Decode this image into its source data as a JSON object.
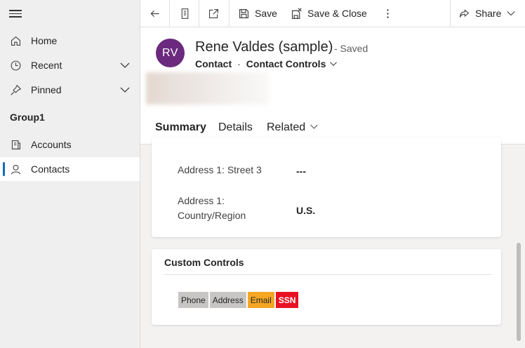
{
  "sidebar": {
    "items": [
      {
        "label": "Home",
        "icon": "home-icon"
      },
      {
        "label": "Recent",
        "icon": "clock-icon",
        "expandable": true
      },
      {
        "label": "Pinned",
        "icon": "pin-icon",
        "expandable": true
      }
    ],
    "group_label": "Group1",
    "group_items": [
      {
        "label": "Accounts",
        "icon": "accounts-icon"
      },
      {
        "label": "Contacts",
        "icon": "person-icon",
        "active": true
      }
    ]
  },
  "commandbar": {
    "save_label": "Save",
    "save_close_label": "Save & Close",
    "share_label": "Share"
  },
  "record": {
    "initials": "RV",
    "title": "Rene Valdes (sample)",
    "status": "- Saved",
    "entity": "Contact",
    "form": "Contact Controls"
  },
  "tabs": [
    {
      "label": "Summary",
      "active": true
    },
    {
      "label": "Details"
    },
    {
      "label": "Related"
    }
  ],
  "address": {
    "street3_label": "Address 1: Street 3",
    "street3_value": "---",
    "country_label_line1": "Address 1:",
    "country_label_line2": "Country/Region",
    "country_value": "U.S."
  },
  "custom_controls": {
    "title": "Custom Controls",
    "chips": [
      {
        "label": "Phone",
        "color": "#c8c6c4"
      },
      {
        "label": "Address",
        "color": "#c8c6c4"
      },
      {
        "label": "Email",
        "color": "#f5a623"
      },
      {
        "label": "SSN",
        "color": "#e81123"
      }
    ]
  },
  "colors": {
    "avatar": "#6b2a7e",
    "accent": "#0f6cbd"
  }
}
